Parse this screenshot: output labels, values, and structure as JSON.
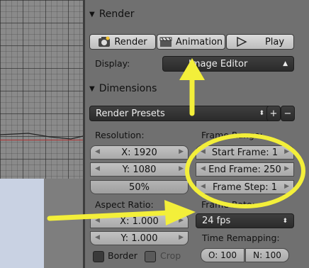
{
  "render_section": {
    "title": "Render",
    "render_label": "Render",
    "animation_label": "Animation",
    "play_label": "Play",
    "display_label": "Display:",
    "display_value": "Image Editor"
  },
  "dimensions_section": {
    "title": "Dimensions",
    "presets_value": "Render Presets",
    "resolution_label": "Resolution:",
    "res_x": "X: 1920",
    "res_y": "Y: 1080",
    "res_pct": "50%",
    "frame_range_label": "Frame Range:",
    "start_frame": "Start Frame: 1",
    "end_frame": "End Frame: 250",
    "frame_step": "Frame Step: 1",
    "aspect_label": "Aspect Ratio:",
    "aspect_x": "X: 1.000",
    "aspect_y": "Y: 1.000",
    "frame_rate_label": "Frame Rate:",
    "fps_value": "24 fps",
    "border_label": "Border",
    "crop_label": "Crop",
    "time_remap_label": "Time Remapping:",
    "remap_old": "O: 100",
    "remap_new": "N: 100"
  },
  "colors": {
    "annotation": "#f3ef3a",
    "panel": "#707070"
  }
}
